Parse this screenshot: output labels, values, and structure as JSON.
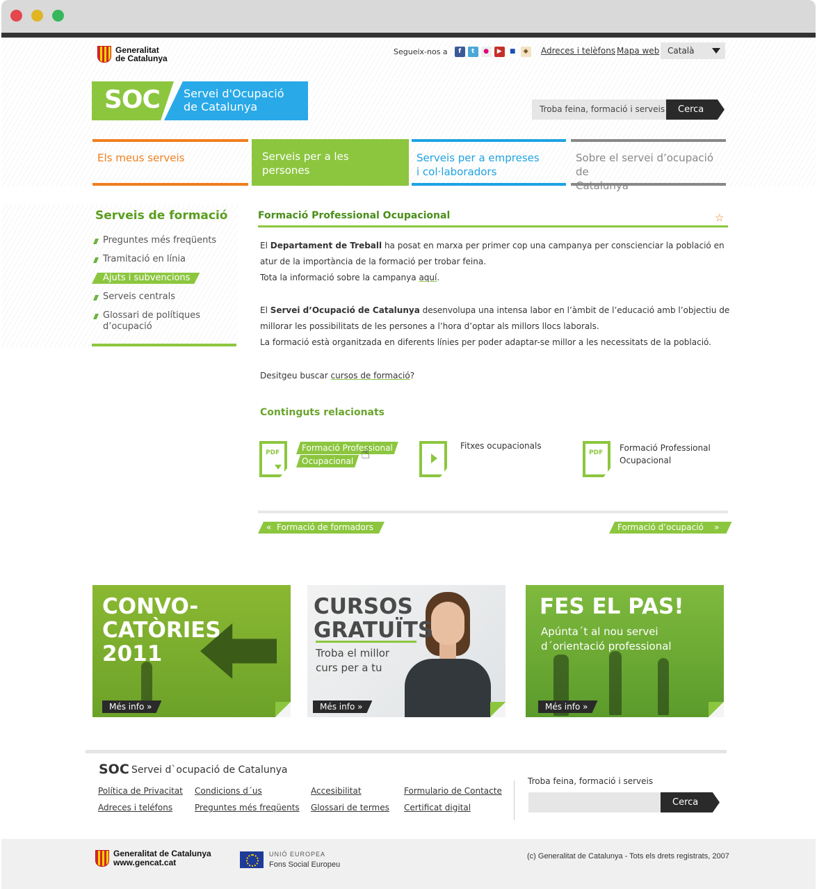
{
  "header": {
    "gencat_line1": "Generalitat",
    "gencat_line2": "de Catalunya",
    "follow_label": "Segueix-nos a",
    "links": [
      "Adreces i telèfons",
      "Mapa web"
    ],
    "language": "Català",
    "logo_short": "SOC",
    "logo_line1": "Servei d'Ocupació",
    "logo_line2": "de Catalunya",
    "search_placeholder": "Troba feina, formació i serveis",
    "search_button": "Cerca"
  },
  "nav": [
    {
      "label": "Els meus serveis"
    },
    {
      "label": "Serveis per a les persones"
    },
    {
      "line1": "Serveis per a empreses",
      "line2": "i col·laboradors"
    },
    {
      "line1": "Sobre el servei d’ocupació de",
      "line2": "Catalunya"
    }
  ],
  "sidebar": {
    "title": "Serveis de formació",
    "items": [
      {
        "label": "Preguntes més freqüents"
      },
      {
        "label": "Tramitació en línia"
      },
      {
        "label": "Ajuts i subvencions"
      },
      {
        "label": "Serveis centrals"
      },
      {
        "label": "Glossari de polítiques d’ocupació"
      }
    ]
  },
  "content": {
    "title": "Formació Professional Ocupacional",
    "p1_pre": "El ",
    "p1_bold": "Departament de Treball",
    "p1_post": " ha posat en marxa per primer cop una campanya per conscienciar la població en atur de la importància de la formació per trobar feina.",
    "p1_line2_pre": "Tota la informació sobre la campanya ",
    "p1_link": "aquí",
    "p1_line2_post": ".",
    "p2_pre": "El ",
    "p2_bold": "Servei d’Ocupació de Catalunya",
    "p2_post": " desenvolupa una intensa labor en l’àmbit de l’educació amb l’objectiu de millorar les possibilitats de les persones a l’hora d’optar als millors llocs laborals.",
    "p2_line2": "La formació està organitzada en diferents línies per poder adaptar-se millor a les necessitats de la població.",
    "p3_pre": "Desitgeu buscar ",
    "p3_link": "cursos de formació",
    "p3_post": "?",
    "related_title": "Continguts relacionats",
    "related": [
      {
        "icon_text": "PDF",
        "line1": "Formació Professional",
        "line2": "Ocupacional"
      },
      {
        "line1": "Fitxes ocupacionals"
      },
      {
        "icon_text": "PDF",
        "line1": "Formació Professional",
        "line2": "Ocupacional"
      }
    ],
    "prev_label": "Formació de formadors",
    "prev_icon": "«",
    "next_label": "Formació d’ocupació",
    "next_icon": "»"
  },
  "banners": [
    {
      "title_l1": "CONVO-",
      "title_l2": "CATÒRIES",
      "title_l3": "2011",
      "more": "Més info »"
    },
    {
      "title_l1": "CURSOS",
      "title_l2": "GRATUÏTS",
      "sub_l1": "Troba el millor",
      "sub_l2": "curs per a tu",
      "more": "Més info »"
    },
    {
      "title_l1": "FES EL PAS!",
      "sub_l1": "Apúnta´t al nou servei",
      "sub_l2": "d´orientació professional",
      "more": "Més info »"
    }
  ],
  "footer": {
    "soc": "SOC",
    "name": "Servei d`ocupació de Catalunya",
    "links": [
      "Política de Privacitat",
      "Condicions d´us",
      "Accesibilitat",
      "Formulario de Contacte",
      "Adreces i teléfons",
      "Preguntes més freqüents",
      "Glossari de termes",
      "Certificat digital"
    ],
    "search_label": "Troba feina, formació i serveis",
    "search_button": "Cerca",
    "gencat_line1": "Generalitat de Catalunya",
    "gencat_line2": "www.gencat.cat",
    "eu_line1": "UNIÓ EUROPEA",
    "eu_line2": "Fons Social Europeu",
    "copyright": "(c) Generalitat de Catalunya - Tots els drets registrats, 2007"
  }
}
